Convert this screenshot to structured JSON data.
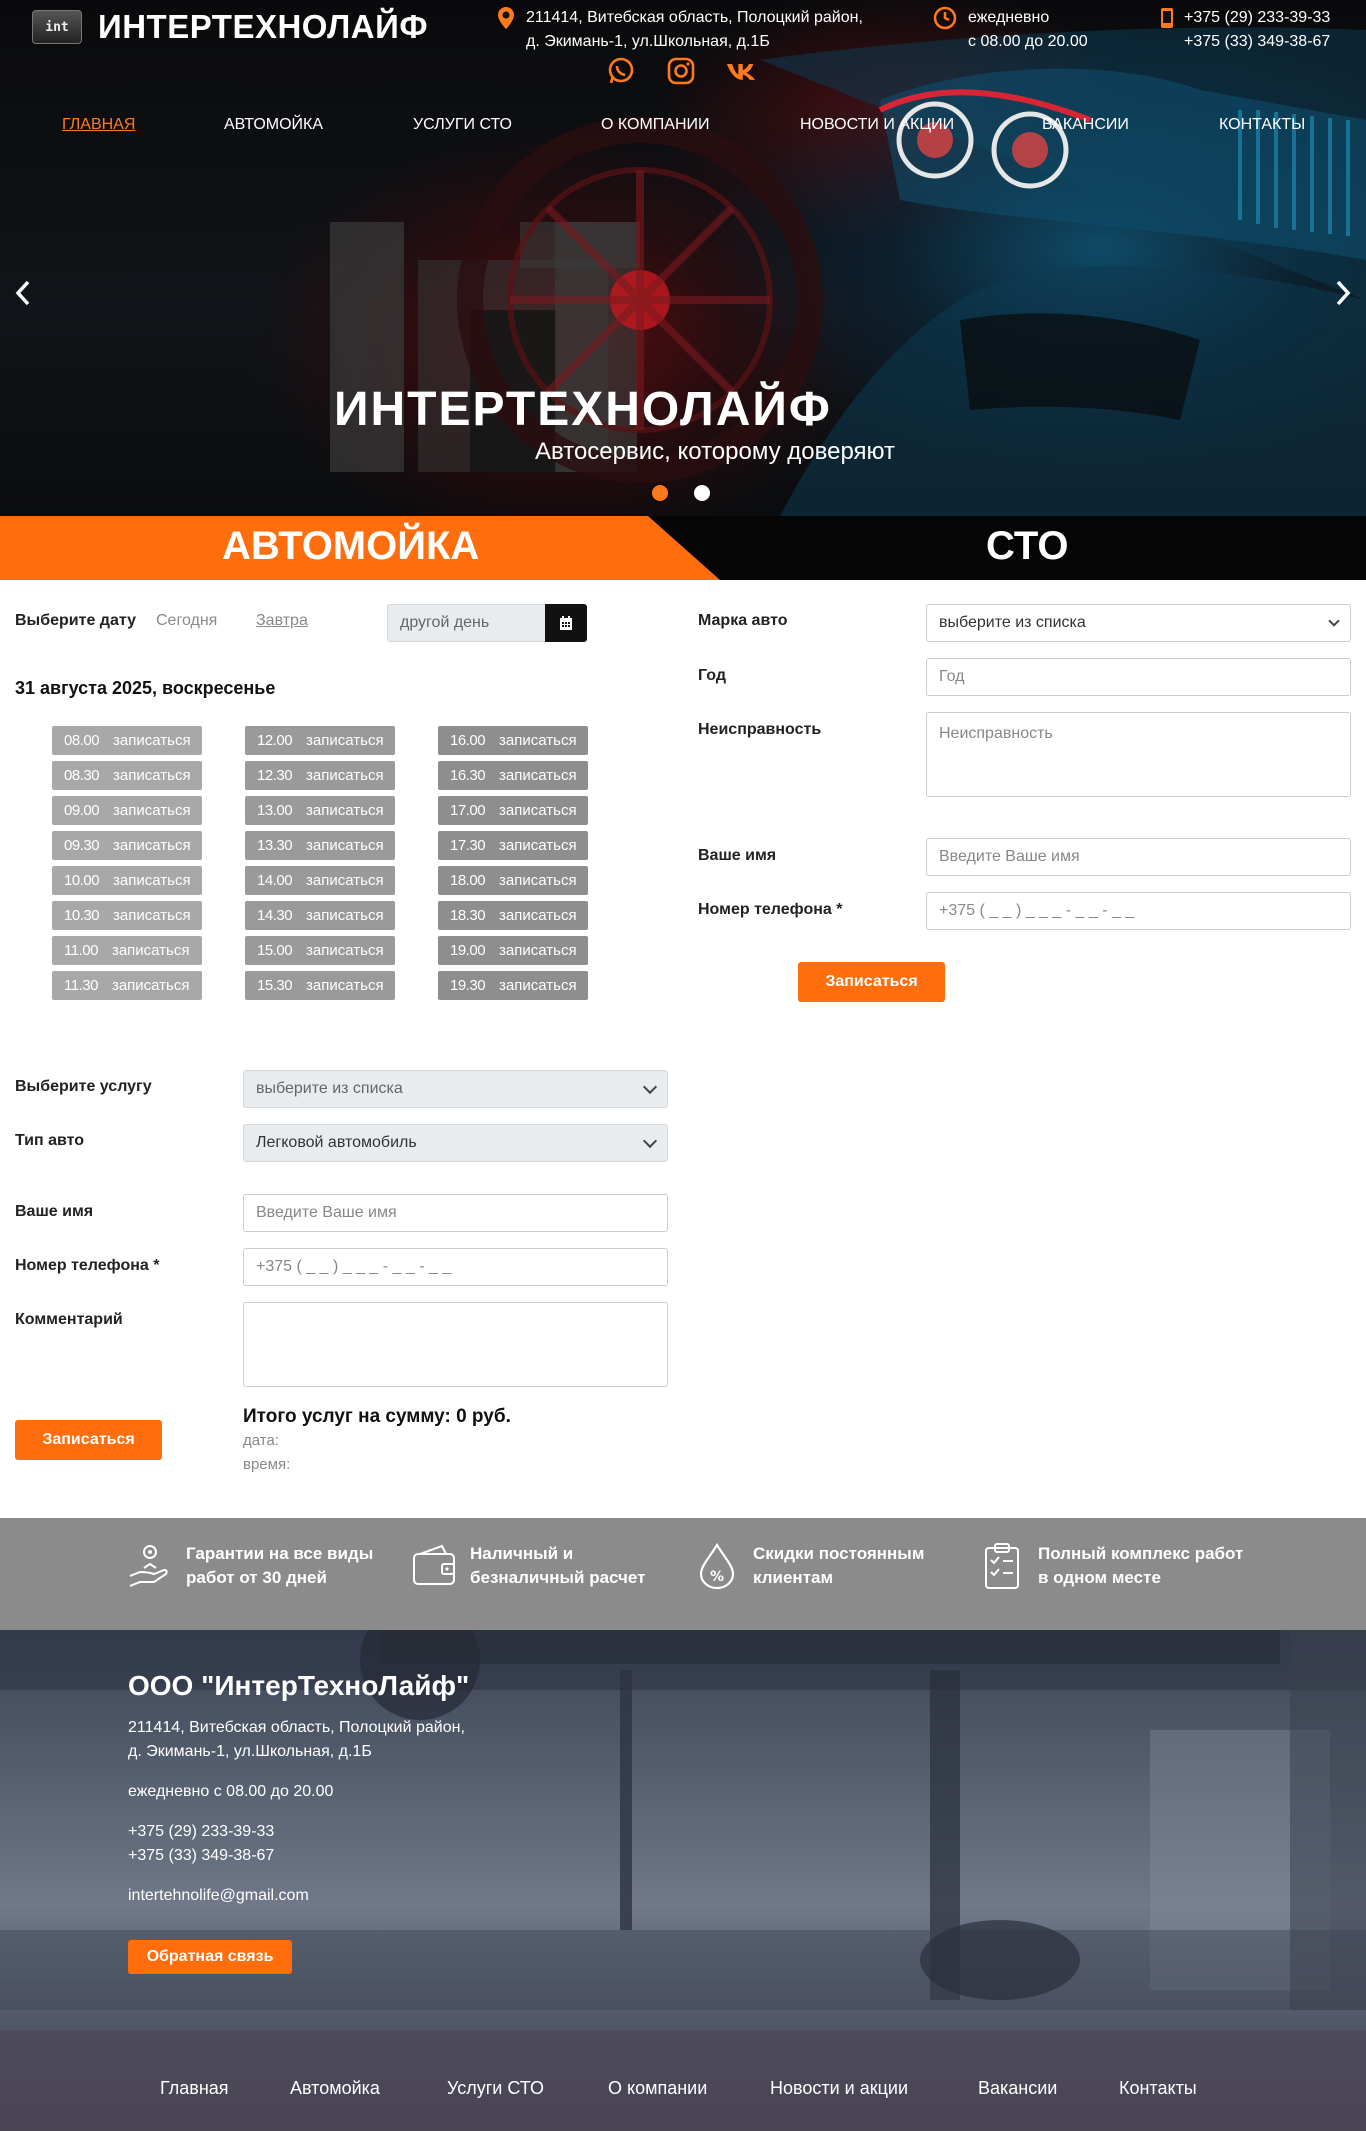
{
  "header": {
    "logo_mark": "int",
    "brand": "ИНТЕРТЕХНОЛАЙФ",
    "address_line1": "211414, Витебская область, Полоцкий район,",
    "address_line2": "д. Экимань-1, ул.Школьная, д.1Б",
    "hours_line1": "ежедневно",
    "hours_line2": "с 08.00 до 20.00",
    "phone1": "+375 (29) 233-39-33",
    "phone2": "+375 (33) 349-38-67",
    "social_icons": [
      "whatsapp-icon",
      "instagram-icon",
      "vk-icon"
    ]
  },
  "nav": {
    "items": [
      "Главная",
      "Автомойка",
      "Услуги СТО",
      "О компании",
      "Новости и акции",
      "Вакансии",
      "Контакты"
    ],
    "active_index": 0
  },
  "hero": {
    "title": "ИНТЕРТЕХНОЛАЙФ",
    "subtitle": "Автосервис, которому доверяют",
    "slides_total": 2,
    "active_slide": 1
  },
  "tabs": {
    "carwash": "АВТОМОЙКА",
    "sto": "СТО"
  },
  "carwash_form": {
    "date_label": "Выберите дату",
    "today": "Сегодня",
    "tomorrow": "Завтра",
    "other_day_placeholder": "другой день",
    "selected_date": "31 августа 2025, воскресенье",
    "slot_action": "записаться",
    "slots_col1": [
      "08.00",
      "08.30",
      "09.00",
      "09.30",
      "10.00",
      "10.30",
      "11.00",
      "11.30"
    ],
    "slots_col2": [
      "12.00",
      "12.30",
      "13.00",
      "13.30",
      "14.00",
      "14.30",
      "15.00",
      "15.30"
    ],
    "slots_col3": [
      "16.00",
      "16.30",
      "17.00",
      "17.30",
      "18.00",
      "18.30",
      "19.00",
      "19.30"
    ],
    "service_label": "Выберите услугу",
    "service_value": "выберите из списка",
    "car_type_label": "Тип авто",
    "car_type_value": "Легковой автомобиль",
    "name_label": "Ваше имя",
    "name_placeholder": "Введите Ваше имя",
    "phone_label": "Номер телефона *",
    "phone_placeholder": "+375 ( _ _ ) _ _ _ - _ _ - _ _",
    "comment_label": "Комментарий",
    "submit": "Записаться",
    "total": "Итого услуг на сумму: 0 руб.",
    "date_meta": "дата:",
    "time_meta": "время:"
  },
  "sto_form": {
    "brand_label": "Марка авто",
    "brand_value": "выберите из списка",
    "year_label": "Год",
    "year_placeholder": "Год",
    "fault_label": "Неисправность",
    "fault_placeholder": "Неисправность",
    "name_label": "Ваше имя",
    "name_placeholder": "Введите Ваше имя",
    "phone_label": "Номер телефона *",
    "phone_placeholder": "+375 ( _ _ ) _ _ _ - _ _ - _ _",
    "submit": "Записаться"
  },
  "features": [
    {
      "icon": "warranty-hand-icon",
      "line1": "Гарантии на все виды",
      "line2": "работ от 30 дней"
    },
    {
      "icon": "wallet-icon",
      "line1": "Наличный и",
      "line2": "безналичный расчет"
    },
    {
      "icon": "discount-drop-icon",
      "line1": "Скидки постоянным",
      "line2": "клиентам"
    },
    {
      "icon": "checklist-icon",
      "line1": "Полный комплекс работ",
      "line2": "в одном месте"
    }
  ],
  "footer": {
    "company": "ООО \"ИнтерТехноЛайф\"",
    "address_line1": "211414, Витебская область, Полоцкий район,",
    "address_line2": "д. Экимань-1, ул.Школьная, д.1Б",
    "hours": "ежедневно с 08.00 до 20.00",
    "phone1": "+375 (29) 233-39-33",
    "phone2": "+375 (33) 349-38-67",
    "email": "intertehnolife@gmail.com",
    "feedback_button": "Обратная связь",
    "nav": [
      "Главная",
      "Автомойка",
      "Услуги СТО",
      "О компании",
      "Новости и акции",
      "Вакансии",
      "Контакты"
    ]
  },
  "colors": {
    "accent": "#ff6d0c",
    "dark": "#050505",
    "slot_grey": "#9a9a9a",
    "features_bg": "#8b8b8b"
  }
}
